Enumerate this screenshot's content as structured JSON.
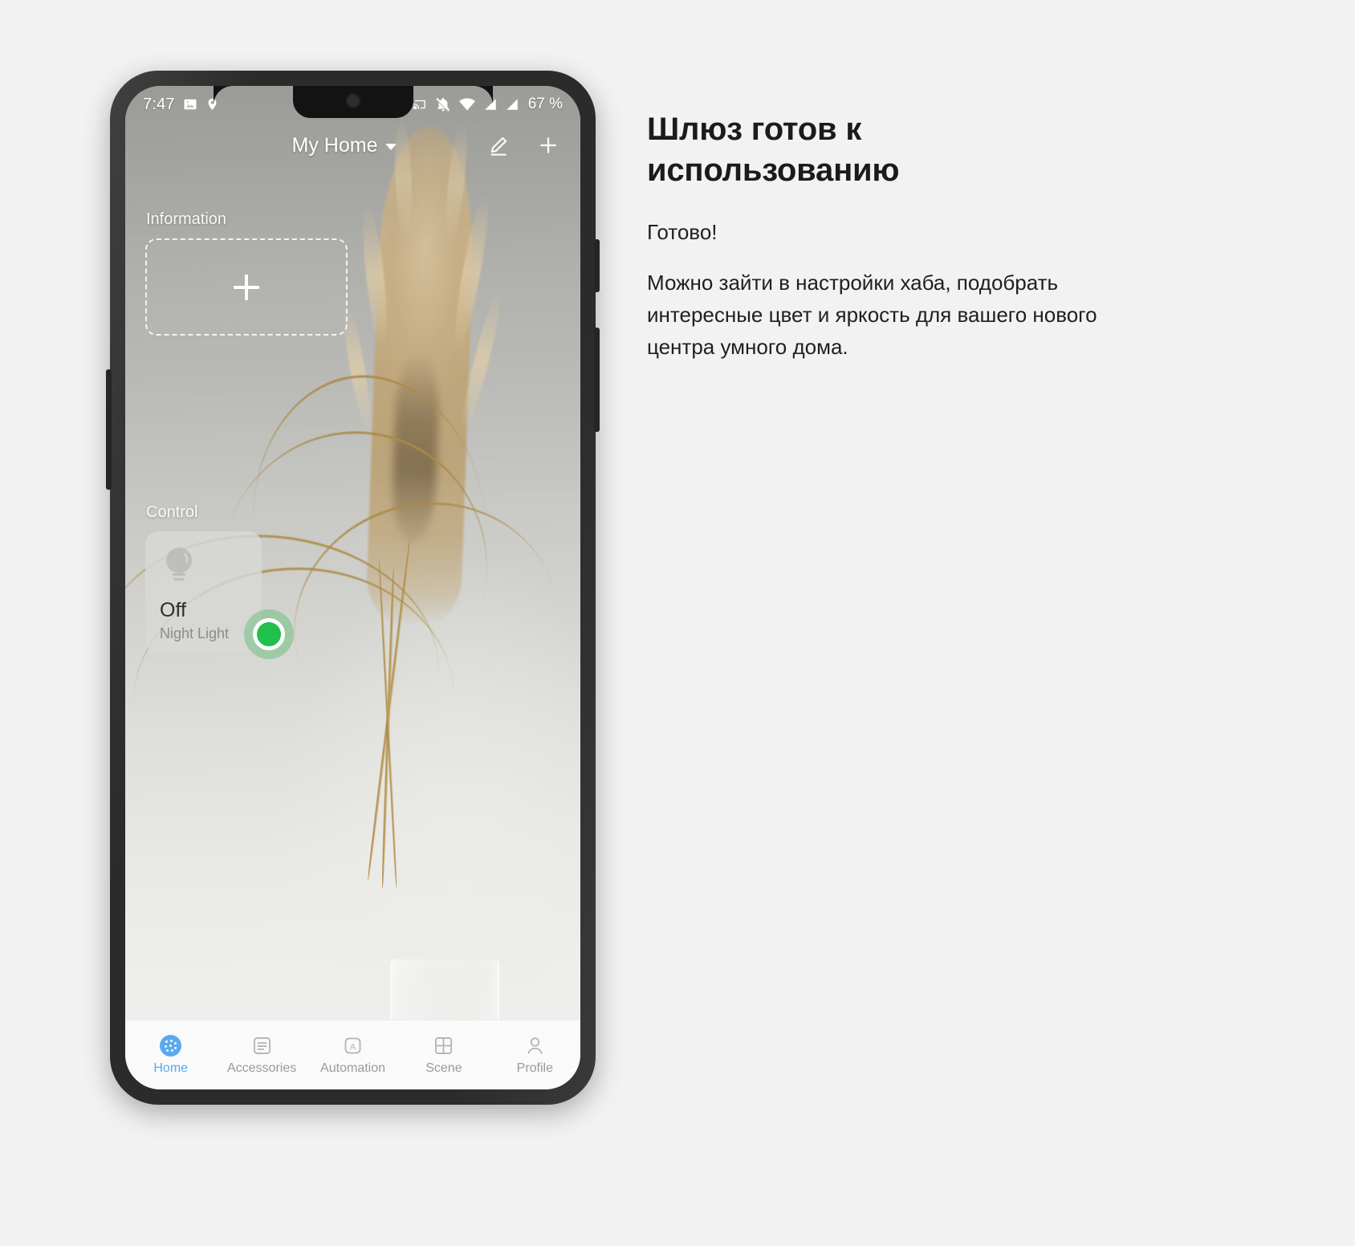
{
  "phone": {
    "status_bar": {
      "time": "7:47",
      "icons_left": [
        "image-icon",
        "location-pin-icon"
      ],
      "icons_right": [
        "screen-cast-icon",
        "notifications-muted-icon",
        "wifi-icon",
        "signal-icon",
        "signal-icon"
      ],
      "battery": "67 %"
    },
    "header": {
      "title": "My Home",
      "dropdown_icon": "chevron-down-icon",
      "edit_icon": "pencil-icon",
      "add_icon": "plus-icon"
    },
    "sections": {
      "information": {
        "label": "Information",
        "add_placeholder_icon": "plus-icon"
      },
      "control": {
        "label": "Control",
        "device": {
          "icon": "light-bulb-icon",
          "state": "Off",
          "name": "Night Light"
        }
      }
    },
    "touch_indicator": {
      "name": "tap-indicator",
      "color": "#21bf4b"
    },
    "bottom_nav": {
      "active": "Home",
      "items": [
        {
          "label": "Home",
          "icon": "home-dots-icon"
        },
        {
          "label": "Accessories",
          "icon": "list-icon"
        },
        {
          "label": "Automation",
          "icon": "automation-a-icon"
        },
        {
          "label": "Scene",
          "icon": "grid-icon"
        },
        {
          "label": "Profile",
          "icon": "person-icon"
        }
      ]
    }
  },
  "text_panel": {
    "headline": "Шлюз готов к использованию",
    "lead": "Готово!",
    "body": "Можно зайти в настройки хаба, подобрать интересные цвет и яркость для вашего нового центра умного дома."
  },
  "colors": {
    "accent": "#5aa9f0",
    "indicator_green": "#21bf4b",
    "page_background": "#f2f2f2",
    "text_primary": "#1b1b1b"
  }
}
